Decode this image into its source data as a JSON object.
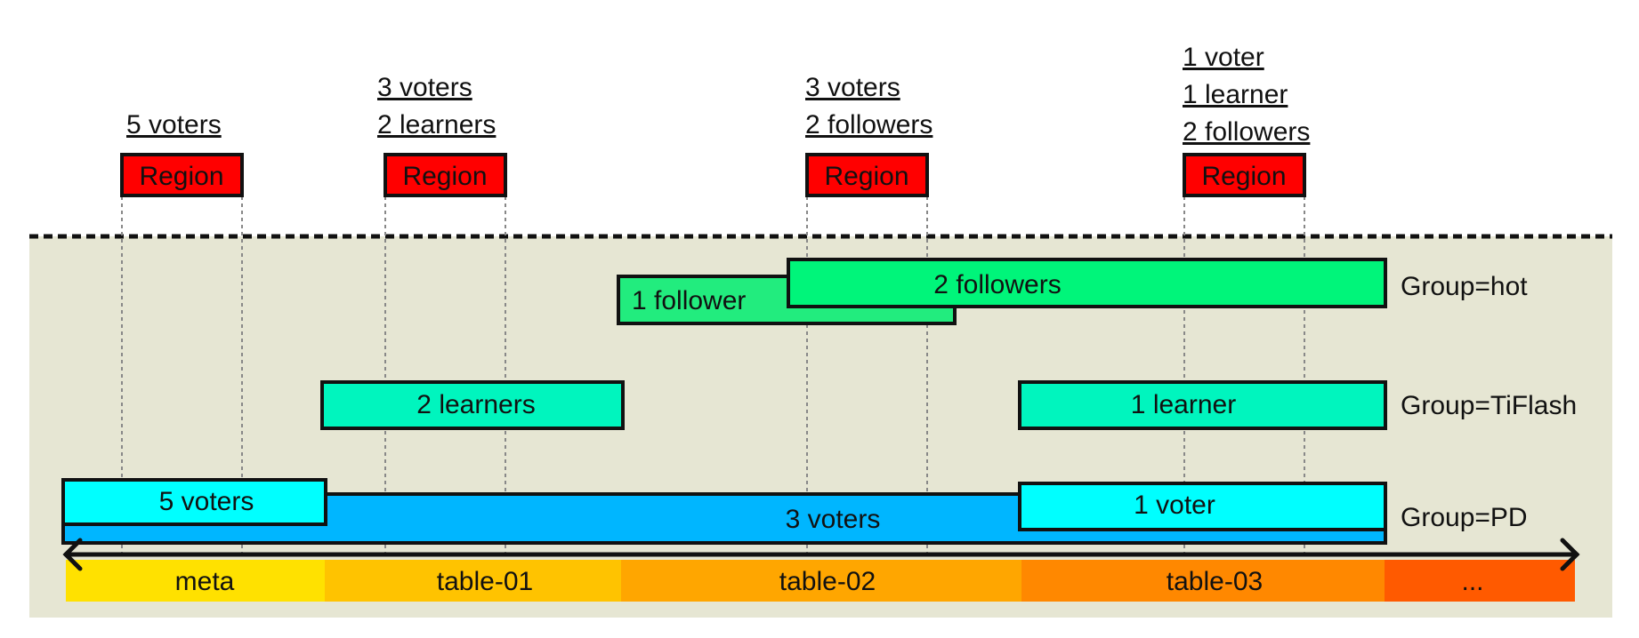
{
  "regions": [
    {
      "label": "Region",
      "replicas": [
        "5 voters"
      ]
    },
    {
      "label": "Region",
      "replicas": [
        "3 voters",
        "2 learners"
      ]
    },
    {
      "label": "Region",
      "replicas": [
        "3 voters",
        "2 followers"
      ]
    },
    {
      "label": "Region",
      "replicas": [
        "1 voter",
        "1 learner",
        "2 followers"
      ]
    }
  ],
  "groups": {
    "hot": {
      "label": "Group=hot",
      "rules": [
        "1 follower",
        "2 followers"
      ]
    },
    "tiflash": {
      "label": "Group=TiFlash",
      "rules": [
        "2 learners",
        "1 learner"
      ]
    },
    "pd": {
      "label": "Group=PD",
      "rules": [
        "3 voters",
        "5 voters",
        "1 voter"
      ]
    }
  },
  "key_ranges": [
    "meta",
    "table-01",
    "table-02",
    "table-03",
    "..."
  ],
  "colors": {
    "region": "#FF0000",
    "background": "#E6E6D3",
    "follower": "#00F57A",
    "learner": "#00F5BE",
    "voter_light": "#00FFFF",
    "voter_dark": "#00B6FF",
    "ranges": [
      "#FFE100",
      "#FFC300",
      "#FFA600",
      "#FF8800",
      "#FF5A00"
    ]
  }
}
